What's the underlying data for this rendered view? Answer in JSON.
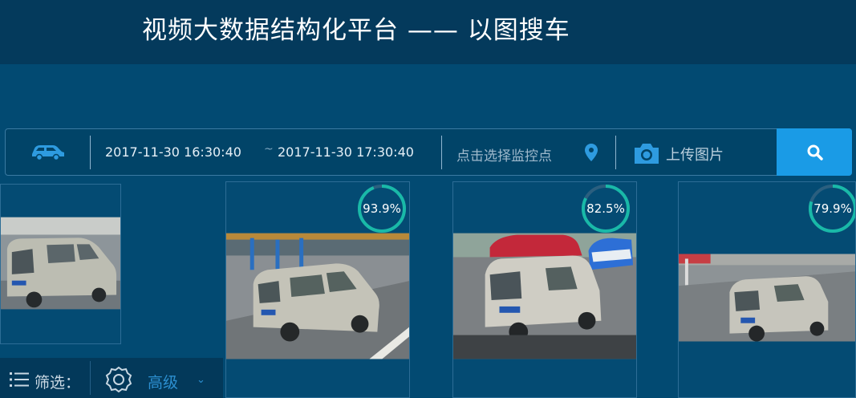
{
  "header": {
    "title": "视频大数据结构化平台 —— 以图搜车"
  },
  "search": {
    "start_time": "2017-11-30 16:30:40",
    "separator": "~",
    "end_time": "2017-11-30 17:30:40",
    "location_placeholder": "点击选择监控点",
    "upload_label": "上传图片"
  },
  "results": [
    {
      "score": "93.9%"
    },
    {
      "score": "82.5%"
    },
    {
      "score": "79.9%"
    }
  ],
  "filter": {
    "label": "筛选：",
    "advanced_label": "高级",
    "dropdown_arrow": "⌄"
  },
  "colors": {
    "accent": "#1a9be6",
    "score_ring": "#19b9a8",
    "background": "#024a72"
  }
}
